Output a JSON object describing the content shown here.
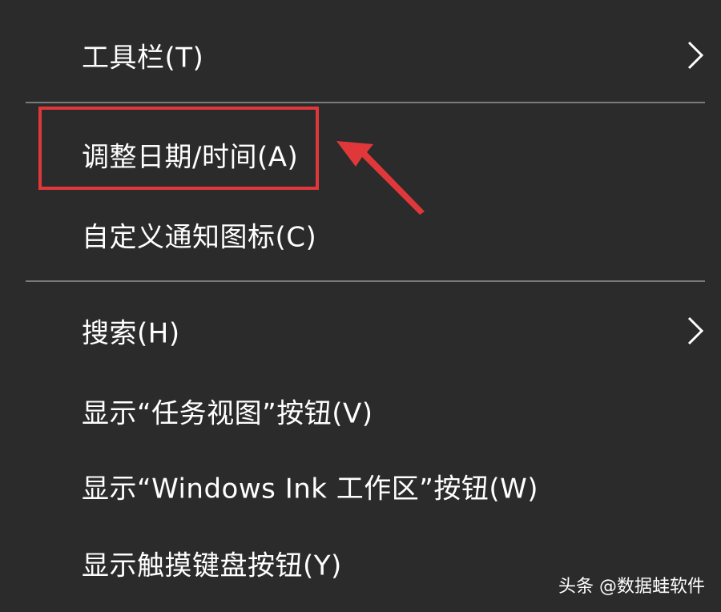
{
  "context_menu": {
    "items": [
      {
        "label": "工具栏(T)",
        "has_submenu": true
      },
      {
        "label": "调整日期/时间(A)",
        "has_submenu": false,
        "highlighted": true
      },
      {
        "label": "自定义通知图标(C)",
        "has_submenu": false
      },
      {
        "label": "搜索(H)",
        "has_submenu": true
      },
      {
        "label": "显示“任务视图”按钮(V)",
        "has_submenu": false
      },
      {
        "label": "显示“Windows Ink 工作区”按钮(W)",
        "has_submenu": false
      },
      {
        "label": "显示触摸键盘按钮(Y)",
        "has_submenu": false
      }
    ]
  },
  "annotation": {
    "color": "#e0383a"
  },
  "colors": {
    "background": "#2b2b2b",
    "text": "#ffffff",
    "separator": "#7a7a7a"
  },
  "watermark": {
    "text": "头条 @数据蛙软件"
  }
}
